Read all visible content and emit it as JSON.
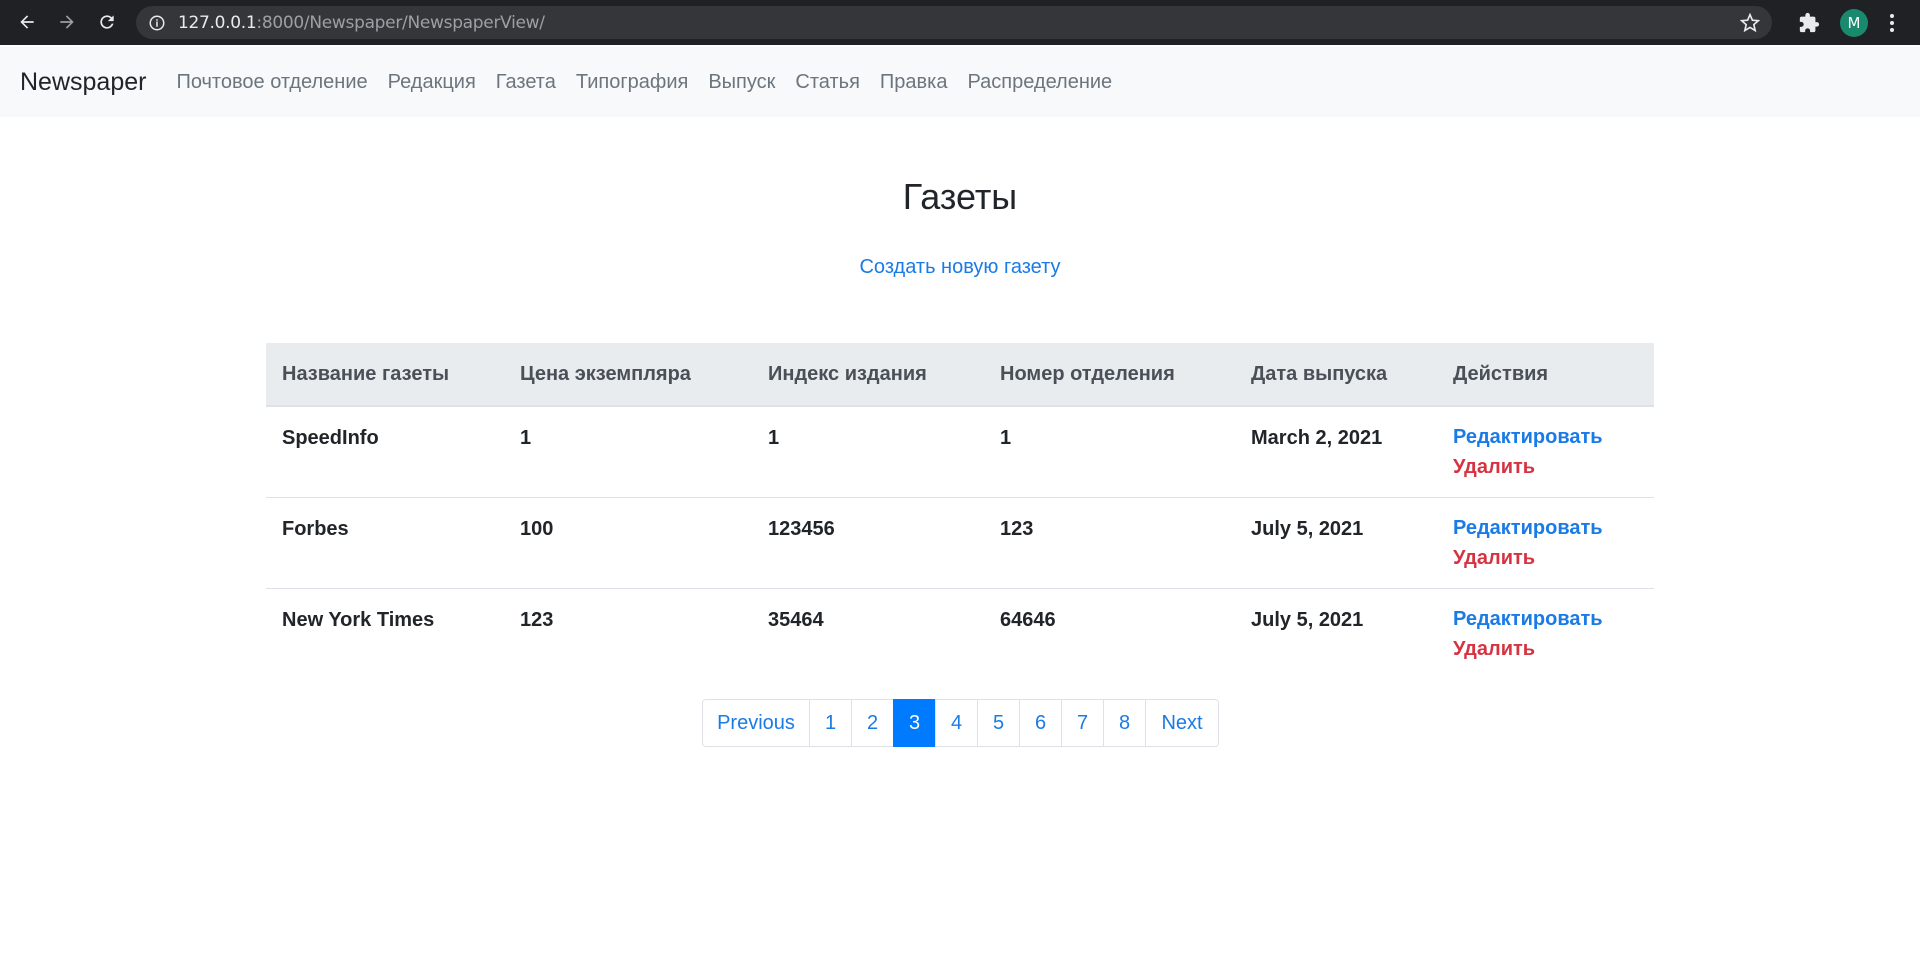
{
  "browser": {
    "url_host": "127.0.0.1",
    "url_rest": ":8000/Newspaper/NewspaperView/",
    "profile_initial": "M"
  },
  "navbar": {
    "brand": "Newspaper",
    "links": [
      {
        "label": "Почтовое отделение"
      },
      {
        "label": "Редакция"
      },
      {
        "label": "Газета"
      },
      {
        "label": "Типография"
      },
      {
        "label": "Выпуск"
      },
      {
        "label": "Статья"
      },
      {
        "label": "Правка"
      },
      {
        "label": "Распределение"
      }
    ]
  },
  "page": {
    "title": "Газеты",
    "create_link": "Создать новую газету"
  },
  "table": {
    "headers": [
      "Название газеты",
      "Цена экземпляра",
      "Индекс издания",
      "Номер отделения",
      "Дата выпуска",
      "Действия"
    ],
    "rows": [
      {
        "name": "SpeedInfo",
        "price": "1",
        "index": "1",
        "branch": "1",
        "date": "March 2, 2021",
        "edit": "Редактировать",
        "delete": "Удалить"
      },
      {
        "name": "Forbes",
        "price": "100",
        "index": "123456",
        "branch": "123",
        "date": "July 5, 2021",
        "edit": "Редактировать",
        "delete": "Удалить"
      },
      {
        "name": "New York Times",
        "price": "123",
        "index": "35464",
        "branch": "64646",
        "date": "July 5, 2021",
        "edit": "Редактировать",
        "delete": "Удалить"
      }
    ]
  },
  "pagination": {
    "previous": "Previous",
    "next": "Next",
    "pages": [
      "1",
      "2",
      "3",
      "4",
      "5",
      "6",
      "7",
      "8"
    ],
    "current": "3"
  },
  "colors": {
    "link": "#1a7be6",
    "danger": "#d63342",
    "active_page": "#007bff",
    "header_bg": "#e9ecef"
  }
}
